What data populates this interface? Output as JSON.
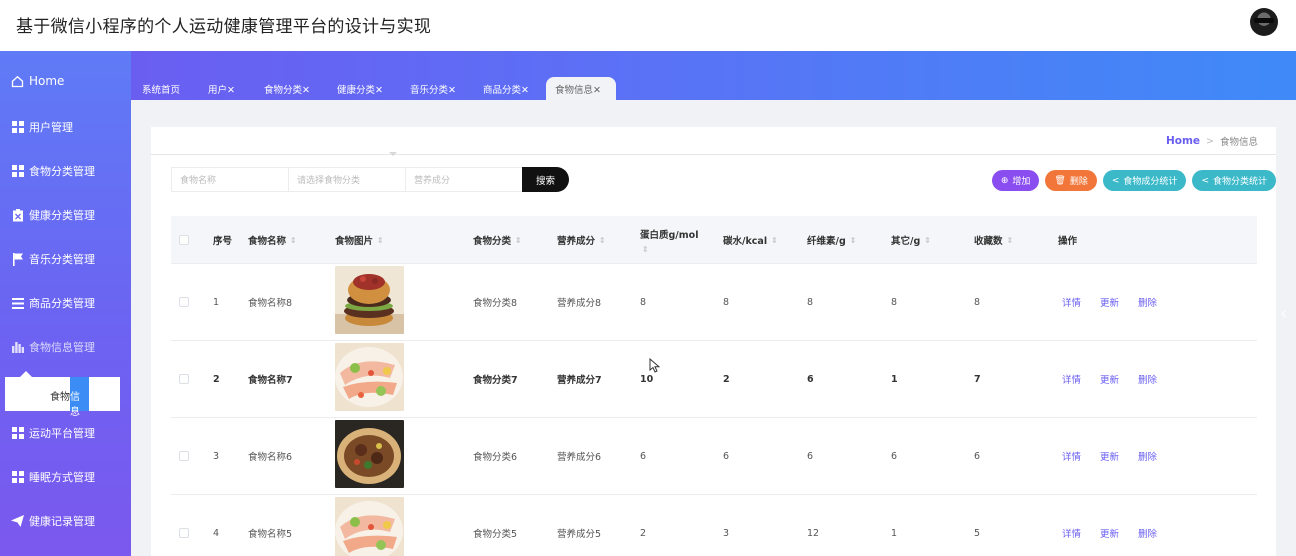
{
  "app": {
    "title": "基于微信小程序的个人运动健康管理平台的设计与实现"
  },
  "sidebar": {
    "items": [
      {
        "label": "Home",
        "icon": "home-icon"
      },
      {
        "label": "用户管理",
        "icon": "grid-icon"
      },
      {
        "label": "食物分类管理",
        "icon": "grid-icon"
      },
      {
        "label": "健康分类管理",
        "icon": "clipboard-icon"
      },
      {
        "label": "音乐分类管理",
        "icon": "flag-icon"
      },
      {
        "label": "商品分类管理",
        "icon": "list-icon"
      },
      {
        "label": "食物信息管理",
        "icon": "bar-chart-icon"
      },
      {
        "label": "运动平台管理",
        "icon": "grid-icon"
      },
      {
        "label": "睡眠方式管理",
        "icon": "grid-icon"
      },
      {
        "label": "健康记录管理",
        "icon": "send-icon"
      }
    ],
    "submenu": {
      "label_a": "食物",
      "label_b": "信息"
    }
  },
  "tabs": [
    {
      "label": "系统首页"
    },
    {
      "label": "用户✕"
    },
    {
      "label": "食物分类✕"
    },
    {
      "label": "健康分类✕"
    },
    {
      "label": "音乐分类✕"
    },
    {
      "label": "商品分类✕"
    },
    {
      "label": "食物信息✕",
      "active": true
    }
  ],
  "breadcrumb": {
    "home": "Home",
    "sep": ">",
    "current": "食物信息"
  },
  "search": {
    "name_placeholder": "食物名称",
    "category_placeholder": "请选择食物分类",
    "nutrition_placeholder": "营养成分",
    "button": "搜索"
  },
  "actions": {
    "add": "增加",
    "delete": "删除",
    "stat_nutrition": "食物成分统计",
    "stat_category": "食物分类统计"
  },
  "colors": {
    "accent": "#6a5ef1",
    "add": "#8a4df0",
    "delete": "#f2763a",
    "stat": "#3bb9c9"
  },
  "table": {
    "headers": {
      "index": "序号",
      "name": "食物名称",
      "image": "食物图片",
      "category": "食物分类",
      "nutrition": "营养成分",
      "protein": "蛋白质g/mol",
      "carb": "碳水/kcal",
      "fiber": "纤维素/g",
      "other": "其它/g",
      "fav": "收藏数",
      "ops": "操作"
    },
    "ops": {
      "detail": "详情",
      "update": "更新",
      "delete": "删除"
    },
    "rows": [
      {
        "index": "1",
        "name": "食物名称8",
        "category": "食物分类8",
        "nutrition": "营养成分8",
        "protein": "8",
        "carb": "8",
        "fiber": "8",
        "other": "8",
        "fav": "8",
        "image": "burger"
      },
      {
        "index": "2",
        "name": "食物名称7",
        "category": "食物分类7",
        "nutrition": "营养成分7",
        "protein": "10",
        "carb": "2",
        "fiber": "6",
        "other": "1",
        "fav": "7",
        "image": "plate"
      },
      {
        "index": "3",
        "name": "食物名称6",
        "category": "食物分类6",
        "nutrition": "营养成分6",
        "protein": "6",
        "carb": "6",
        "fiber": "6",
        "other": "6",
        "fav": "6",
        "image": "bowl"
      },
      {
        "index": "4",
        "name": "食物名称5",
        "category": "食物分类5",
        "nutrition": "营养成分5",
        "protein": "2",
        "carb": "3",
        "fiber": "12",
        "other": "1",
        "fav": "5",
        "image": "plate"
      }
    ]
  }
}
